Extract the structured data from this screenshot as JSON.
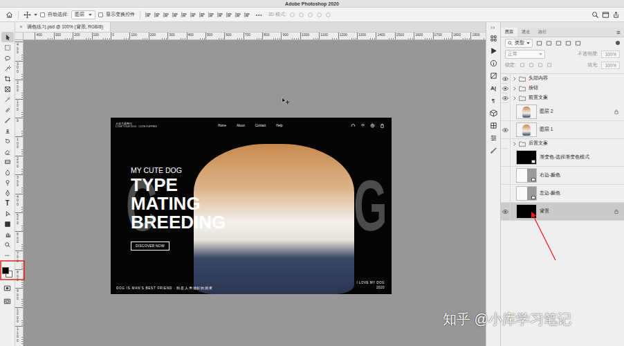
{
  "window": {
    "title": "Adobe Photoshop 2020"
  },
  "options_bar": {
    "auto_select_label": "自动选择:",
    "auto_select_checked": false,
    "auto_select_target": "图层",
    "show_transform_label": "显示变换控件",
    "show_transform_checked": false,
    "more": "•••",
    "mode_3d_label": "3D 模式:"
  },
  "document_tab": {
    "title": "调色练习.psd @ 100% (背景, RGB/8)",
    "close": "×"
  },
  "ruler": {
    "top": [
      "400",
      "300",
      "200",
      "100",
      "0",
      "100",
      "200",
      "300",
      "400",
      "500",
      "600",
      "700",
      "800",
      "900",
      "1000",
      "1100",
      "1200",
      "1300",
      "1400",
      "1500",
      "1600",
      "1700",
      "1800",
      "1900"
    ],
    "left": [
      "400",
      "300",
      "200",
      "100",
      "0",
      "100",
      "200",
      "300",
      "400",
      "500",
      "600",
      "700",
      "800",
      "900",
      "1000",
      "1100"
    ]
  },
  "toolbar": {
    "tools": [
      {
        "selected": true
      },
      {
        "selected": false
      },
      {
        "selected": false
      },
      {
        "selected": false
      },
      {
        "selected": false
      },
      {
        "selected": false
      },
      {
        "selected": false
      },
      {
        "selected": false
      },
      {
        "selected": false
      },
      {
        "selected": false
      },
      {
        "selected": false
      },
      {
        "selected": false
      },
      {
        "selected": false
      },
      {
        "selected": false
      },
      {
        "selected": false
      },
      {
        "selected": false
      },
      {
        "selected": false,
        "glyph": "T"
      },
      {
        "selected": false
      },
      {
        "selected": false
      },
      {
        "selected": false
      },
      {
        "selected": false
      }
    ],
    "more": "•••",
    "swatches": {
      "foreground": "#000000",
      "background": "#ffffff"
    }
  },
  "document": {
    "logo": [
      "犬类主题网站",
      "LOVE YOUR DOG · CUTE PUPPIES"
    ],
    "nav": [
      "Home",
      "About",
      "Contact",
      "Help"
    ],
    "kicker": "MY CUTE DOG",
    "headline": [
      "TYPE",
      "MATING",
      "BREEDING"
    ],
    "button": "DISCOVER NOW",
    "background_left": "C",
    "background_right": "DOG",
    "footer_left": "DOG IS MAN'S BEST FRIEND · 狗是人类最好的朋友",
    "footer_right": [
      "I LOVE MY DOG",
      "2020"
    ]
  },
  "icon_strip": [
    {
      "kind": "icon"
    },
    {
      "kind": "icon"
    },
    {
      "kind": "icon"
    },
    {
      "kind": "icon"
    },
    {
      "kind": "glyph",
      "glyph": "A|"
    },
    {
      "kind": "glyph",
      "glyph": "¶"
    },
    {
      "kind": "icon"
    },
    {
      "kind": "icon"
    },
    {
      "kind": "icon"
    },
    {
      "kind": "icon"
    }
  ],
  "layers_panel": {
    "tabs": [
      {
        "label": "图层",
        "selected": true
      },
      {
        "label": "通道",
        "selected": false
      },
      {
        "label": "路径",
        "selected": false
      }
    ],
    "filter": "类型",
    "blend_mode": "正常",
    "opacity_label": "不透明度:",
    "opacity": "100%",
    "lock_label": "锁定:",
    "fill_label": "填充:",
    "fill": "100%",
    "layers": [
      {
        "name": "头部内容",
        "kind": "folder",
        "visible": true,
        "locked": false,
        "smart": false,
        "selected": false
      },
      {
        "name": "按钮",
        "kind": "folder",
        "visible": true,
        "locked": false,
        "smart": false,
        "selected": false
      },
      {
        "name": "前置文案",
        "kind": "folder",
        "visible": true,
        "locked": false,
        "smart": false,
        "selected": false
      },
      {
        "name": "图层 2",
        "kind": "layer",
        "thumb": "dog",
        "visible": false,
        "locked": true,
        "smart": false,
        "selected": false
      },
      {
        "name": "图层 1",
        "kind": "layer",
        "thumb": "dog",
        "visible": true,
        "locked": false,
        "smart": false,
        "selected": false
      },
      {
        "name": "后置文案",
        "kind": "folder",
        "visible": false,
        "locked": false,
        "smart": false,
        "selected": false
      },
      {
        "name": "渐变色-选择渐变色模式",
        "kind": "layer",
        "thumb": "black",
        "visible": false,
        "locked": false,
        "smart": true,
        "selected": false
      },
      {
        "name": "右边-颜色",
        "kind": "layer",
        "thumb": "gray",
        "visible": false,
        "locked": false,
        "smart": true,
        "selected": false
      },
      {
        "name": "左边-颜色",
        "kind": "layer",
        "thumb": "gray",
        "visible": false,
        "locked": false,
        "smart": true,
        "selected": false
      },
      {
        "name": "背景",
        "kind": "layer",
        "thumb": "black",
        "visible": true,
        "locked": true,
        "smart": false,
        "selected": true
      }
    ]
  },
  "annotations": [
    {
      "kind": "box",
      "color": "#e02020"
    },
    {
      "kind": "arrow",
      "color": "#e02020"
    }
  ],
  "watermark": "知乎 @小库学习笔记"
}
